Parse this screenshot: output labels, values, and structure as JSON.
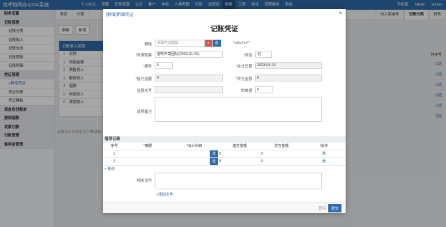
{
  "app": {
    "title": "信呼协同办公OA系统"
  },
  "topnav": [
    "个人办公",
    "流程",
    "任务资源",
    "公文",
    "客户",
    "学校",
    "人事考勤",
    "行政",
    "进销存",
    "财务",
    "工程",
    "物业",
    "流程模块",
    "系统"
  ],
  "topright": [
    "手机版",
    "REIM",
    "admin"
  ],
  "sidebar": [
    {
      "label": "财务设置",
      "group": true
    },
    {
      "label": "记账管理",
      "group": true
    },
    {
      "label": "记账分类",
      "sub": true
    },
    {
      "label": "记账收入",
      "sub": true
    },
    {
      "label": "记账支出",
      "sub": true
    },
    {
      "label": "记账转账",
      "sub": true
    },
    {
      "label": "记账明细",
      "sub": true
    },
    {
      "label": "凭证管理",
      "group": true
    },
    {
      "label": "+新增凭证",
      "sub": true,
      "cur": true
    },
    {
      "label": "凭证列表",
      "sub": true
    },
    {
      "label": "凭证模板",
      "sub": true
    },
    {
      "label": "资金收付款单",
      "group": true
    },
    {
      "label": "报销借款",
      "group": true
    },
    {
      "label": "发票付款",
      "group": true
    },
    {
      "label": "付款管理",
      "group": true
    },
    {
      "label": "备用金管理",
      "group": true
    }
  ],
  "tabs": {
    "home": "首页",
    "calendar": "日程",
    "bg1": "出入库操作",
    "bg2": "记账分类",
    "bg3": "财务"
  },
  "toolbar": {
    "refresh": "刷新",
    "new": "新增"
  },
  "panel": {
    "header": "记账收入类型",
    "col": "名称",
    "rows": [
      "初始金额",
      "销售收入",
      "服务收入",
      "借款",
      "利息收入",
      "其他收入"
    ],
    "note": "设置会计科目是为了带记账:"
  },
  "rcol": {
    "header": "排序号",
    "link": "Q选"
  },
  "modal": {
    "title": "[新增]新增凭证",
    "voucher_title": "记账凭证",
    "template_label": "模板",
    "template_ph": "读取凭证模版",
    "btn_x": "x",
    "btn_select": "选",
    "code_hint": "^akkr2s4^",
    "team_label": "*所属账套",
    "team_value": "信呼开发团队(2023-01-01)",
    "type_label": "*类型",
    "type_value": "记",
    "num_label": "*编号",
    "num_value": "5",
    "date_label": "*会计日期",
    "date_value": "2023-04-10",
    "debit_label": "*借方金额",
    "debit_value": "0",
    "credit_label": "*贷方金额",
    "credit_value": "0",
    "upper_label": "金额大写",
    "attach_label": "附单据",
    "attach_value": "0",
    "remark_label": "说明备注",
    "grid_title": "借贷记录",
    "grid_cols": [
      "序号",
      "*摘要",
      "*会计科目",
      "借方金额",
      "贷方金额",
      "操作"
    ],
    "grid_rows": [
      {
        "no": "1",
        "debit": "0",
        "credit": "0",
        "op": "删"
      },
      {
        "no": "2",
        "debit": "0",
        "credit": "0",
        "op": "删"
      }
    ],
    "add_row": "+ 新增",
    "files_label": "相关文件",
    "add_file": "+添加文件",
    "draft": "暂存",
    "submit": "提交",
    "close": "×"
  }
}
